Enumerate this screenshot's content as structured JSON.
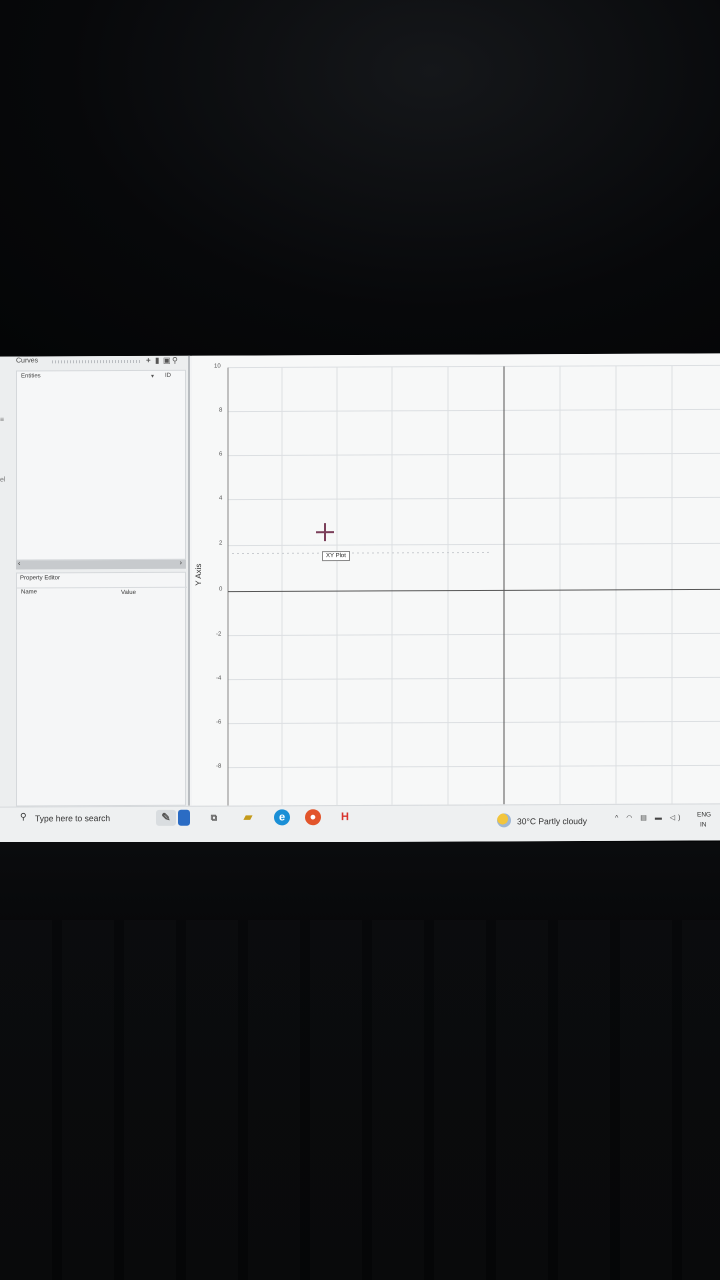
{
  "curves_panel": {
    "title": "Curves",
    "toolbar_icons": [
      "plus-icon",
      "trash-icon",
      "copy-icon",
      "search-icon"
    ],
    "entities_label": "Entities",
    "id_column": "ID"
  },
  "property_editor": {
    "title": "Property Editor",
    "name_column": "Name",
    "value_column": "Value"
  },
  "plot": {
    "y_axis_title": "Y Axis",
    "y_ticks": [
      "10",
      "8",
      "6",
      "4",
      "2",
      "0",
      "-2",
      "-4",
      "-6",
      "-8"
    ],
    "tooltip": "XY Plot",
    "grid": true,
    "axis_color": "#555555"
  },
  "taskbar": {
    "search_placeholder": "Type here to search",
    "apps": [
      "files-icon",
      "task-view-icon",
      "file-explorer-icon",
      "edge-icon",
      "firefox-icon",
      "h-app-icon"
    ],
    "weather": "30°C  Partly cloudy",
    "language_line1": "ENG",
    "language_line2": "IN"
  }
}
